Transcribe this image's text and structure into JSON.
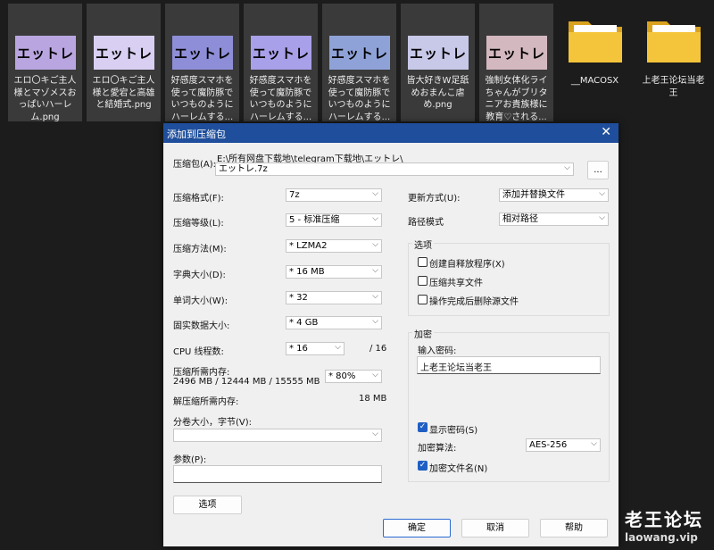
{
  "files": [
    {
      "thumb_text": "エットレ",
      "name": "エロ〇キご主人様とマゾメスおっぱいハーレム.png",
      "bg": "#b9a6e0"
    },
    {
      "thumb_text": "エットレ",
      "name": "エロ〇キご主人様と愛宕と高雄と結婚式.png",
      "bg": "#cfc4ee"
    },
    {
      "thumb_text": "エットレ",
      "name": "好感度スマホを使って魔防豚でいつものようにハーレムする...",
      "bg": "#8e8ed8"
    },
    {
      "thumb_text": "エットレ",
      "name": "好感度スマホを使って魔防豚でいつものようにハーレムする...",
      "bg": "#a8a0e8"
    },
    {
      "thumb_text": "エットレ",
      "name": "好感度スマホを使って魔防豚でいつものようにハーレムする...",
      "bg": "#8fa2d8"
    },
    {
      "thumb_text": "エットレ",
      "name": "皆大好きW足舐めおまんこ虐め.png",
      "bg": "#c8c8e8"
    },
    {
      "thumb_text": "エットレ",
      "name": "強制女体化ライちゃんがブリタニアお貴族様に教育♡される...",
      "bg": "#d4b8c0"
    }
  ],
  "folders": [
    {
      "name": "__MACOSX"
    },
    {
      "name": "上老王论坛当老王"
    }
  ],
  "dialog": {
    "title": "添加到压缩包",
    "close": "✕",
    "archive_label": "压缩包(A):",
    "archive_path": "E:\\所有网盘下载地\\telegram下载地\\エットレ\\",
    "archive_name": "エットレ.7z",
    "browse": "...",
    "format_label": "压缩格式(F):",
    "format": "7z",
    "level_label": "压缩等级(L):",
    "level": "5 - 标准压缩",
    "method_label": "压缩方法(M):",
    "method": "*  LZMA2",
    "dict_label": "字典大小(D):",
    "dict": "*  16 MB",
    "word_label": "单词大小(W):",
    "word": "*  32",
    "solid_label": "固实数据大小:",
    "solid": "*  4 GB",
    "cpu_label": "CPU 线程数:",
    "cpu": "*  16",
    "cpu_total": "/ 16",
    "mem_label": "压缩所需内存:",
    "mem_value": "2496 MB / 12444 MB / 15555 MB",
    "mem_pct": "*  80%",
    "decomp_label": "解压缩所需内存:",
    "decomp_value": "18 MB",
    "volume_label": "分卷大小，字节(V):",
    "volume": "",
    "params_label": "参数(P):",
    "params": "",
    "options_btn": "选项",
    "update_label": "更新方式(U):",
    "update": "添加并替换文件",
    "path_label": "路径模式",
    "path": "相对路径",
    "opt_group": "选项",
    "opt_sfx": "创建自释放程序(X)",
    "opt_shared": "压缩共享文件",
    "opt_delete": "操作完成后删除源文件",
    "enc_group": "加密",
    "pwd_label": "输入密码:",
    "pwd": "上老王论坛当老王",
    "show_pwd": "显示密码(S)",
    "enc_method_label": "加密算法:",
    "enc_method": "AES-256",
    "enc_names": "加密文件名(N)",
    "ok": "确定",
    "cancel": "取消",
    "help": "帮助"
  },
  "watermark": {
    "line1": "老王论坛",
    "line2": "laowang.vip"
  },
  "colors": {
    "titlebar": "#1f4f9c",
    "checkbox_on": "#1f5fc4",
    "folder": "#f4c43a"
  }
}
